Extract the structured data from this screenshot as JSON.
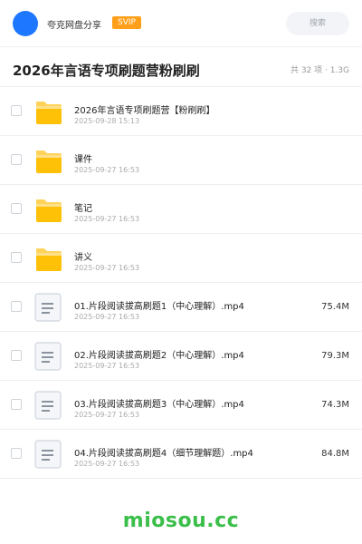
{
  "header": {
    "share_title": "夸克网盘分享",
    "badge": "SVIP",
    "search_placeholder": "搜索",
    "avatar_color": "#1e78ff",
    "badge_color": "#ff9f1a"
  },
  "folder": {
    "title": "2026年言语专项刷题营粉刷刷",
    "meta": "共 32 项 · 1.3G"
  },
  "items": [
    {
      "type": "folder",
      "icon": "folder-icon",
      "name": "2026年言语专项刷题营【粉刷刷】",
      "date": "2025-09-28 15:13",
      "size": ""
    },
    {
      "type": "folder",
      "icon": "folder-icon",
      "name": "课件",
      "date": "2025-09-27 16:53",
      "size": ""
    },
    {
      "type": "folder",
      "icon": "folder-icon",
      "name": "笔记",
      "date": "2025-09-27 16:53",
      "size": ""
    },
    {
      "type": "folder",
      "icon": "folder-icon",
      "name": "讲义",
      "date": "2025-09-27 16:53",
      "size": ""
    },
    {
      "type": "file",
      "icon": "document-icon",
      "name": "01.片段阅读拔高刷题1（中心理解）.mp4",
      "date": "2025-09-27 16:53",
      "size": "75.4M"
    },
    {
      "type": "file",
      "icon": "document-icon",
      "name": "02.片段阅读拔高刷题2（中心理解）.mp4",
      "date": "2025-09-27 16:53",
      "size": "79.3M"
    },
    {
      "type": "file",
      "icon": "document-icon",
      "name": "03.片段阅读拔高刷题3（中心理解）.mp4",
      "date": "2025-09-27 16:53",
      "size": "74.3M"
    },
    {
      "type": "file",
      "icon": "document-icon",
      "name": "04.片段阅读拔高刷题4（细节理解题）.mp4",
      "date": "2025-09-27 16:53",
      "size": "84.8M"
    }
  ],
  "footer": {
    "brand": "miosou.cc",
    "brand_color": "#3cbf4a"
  }
}
